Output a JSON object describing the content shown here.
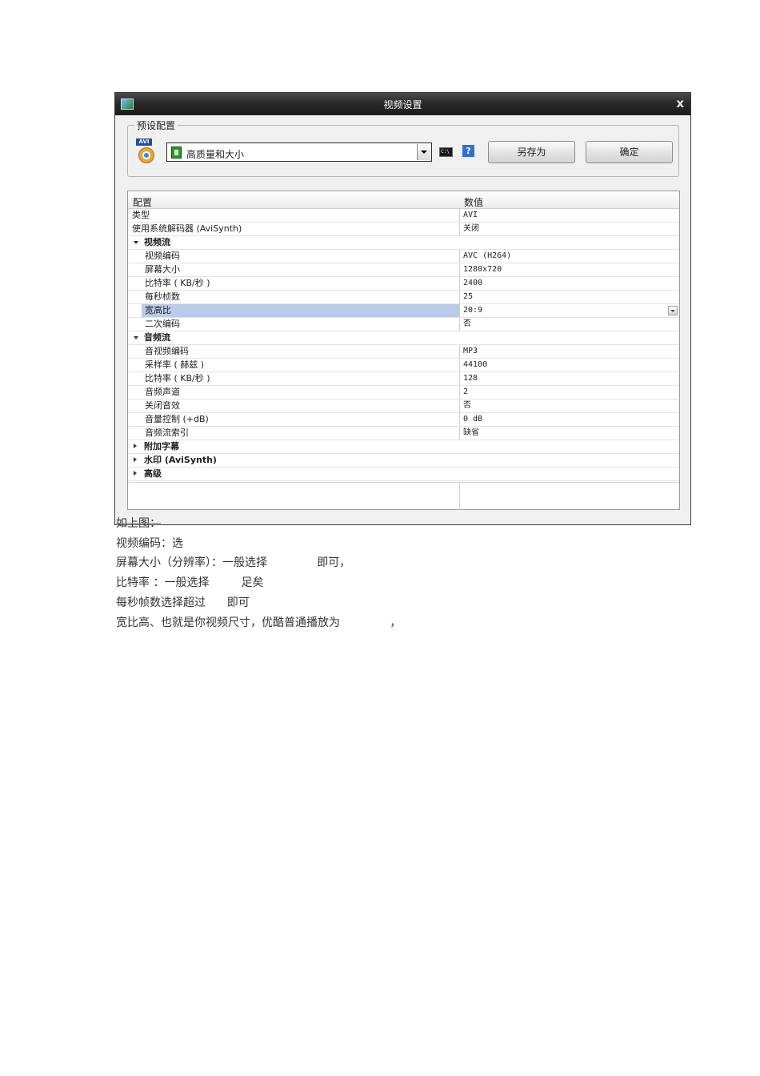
{
  "dialog": {
    "title": "视频设置",
    "close": "x",
    "preset": {
      "legend": "预设配置",
      "icon_label": "AVI",
      "selected": "高质量和大小",
      "cmd_label": "C:\\",
      "help_label": "?",
      "save_as": "另存为",
      "ok": "确定"
    },
    "grid": {
      "col_name": "配置",
      "col_value": "数值",
      "rows": [
        {
          "name": "类型",
          "value": "AVI"
        },
        {
          "name": "使用系统解码器 (AviSynth)",
          "value": "关闭"
        },
        {
          "name": "视频流",
          "value": ""
        },
        {
          "name": "视频编码",
          "value": "AVC (H264)"
        },
        {
          "name": "屏幕大小",
          "value": "1280x720"
        },
        {
          "name": "比特率 ( KB/秒 )",
          "value": "2400"
        },
        {
          "name": "每秒桢数",
          "value": "25"
        },
        {
          "name": "宽高比",
          "value": "20:9"
        },
        {
          "name": "二次编码",
          "value": "否"
        },
        {
          "name": "音频流",
          "value": ""
        },
        {
          "name": "音视频编码",
          "value": "MP3"
        },
        {
          "name": "采样率 ( 赫兹 )",
          "value": "44100"
        },
        {
          "name": "比特率 ( KB/秒 )",
          "value": "128"
        },
        {
          "name": "音频声道",
          "value": "2"
        },
        {
          "name": "关闭音效",
          "value": "否"
        },
        {
          "name": "音量控制 (+dB)",
          "value": "0 dB"
        },
        {
          "name": "音频流索引",
          "value": "缺省"
        },
        {
          "name": "附加字幕",
          "value": ""
        },
        {
          "name": "水印 (AviSynth)",
          "value": ""
        },
        {
          "name": "高级",
          "value": ""
        }
      ]
    }
  },
  "doc": {
    "lines": [
      "如上图：",
      "视频编码：选",
      "屏幕大小（分辨率）：一般选择              即可，",
      "比特率 ：一般选择         足矣",
      "每秒帧数选择超过      即可",
      "宽比高、也就是你视频尺寸，优酷普通播放为              ，"
    ]
  }
}
